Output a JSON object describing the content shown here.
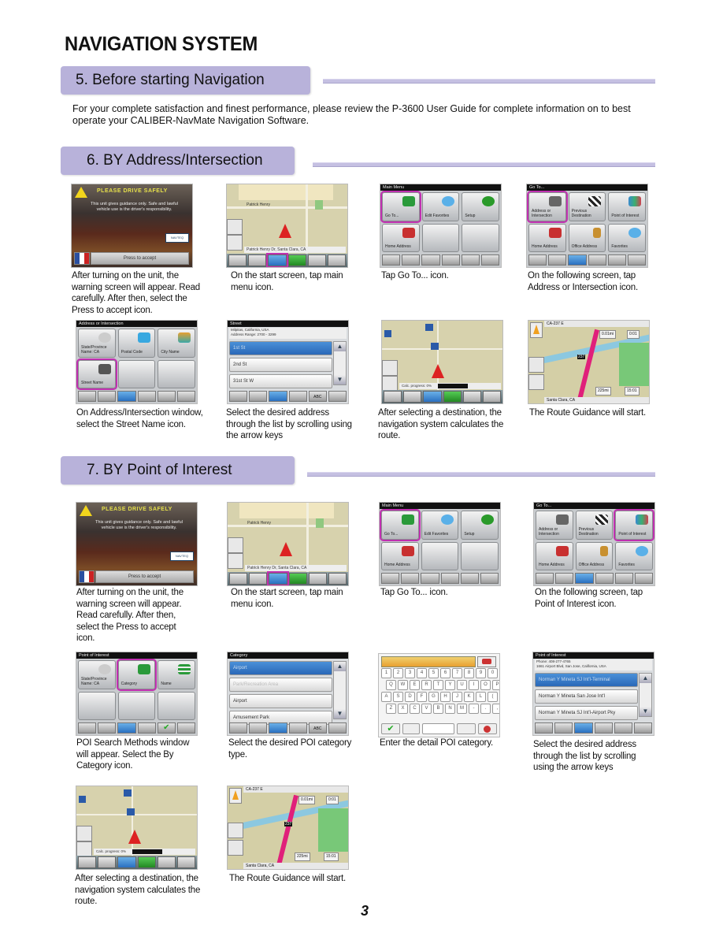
{
  "page": {
    "title": "NAVIGATION SYSTEM",
    "page_number": "3",
    "accent_color": "#b8b2da",
    "highlight_color": "#c030b0"
  },
  "sections": {
    "before": {
      "heading": "5. Before starting Navigation",
      "body": "For your complete satisfaction and finest performance, please review the P-3600 User Guide for complete information on to best operate your CALIBER-NavMate Navigation Software."
    },
    "address": {
      "heading": "6. BY Address/Intersection",
      "steps": [
        {
          "caption": "After turning on the unit, the warning screen will appear. Read carefully. After then, select the Press to accept icon.",
          "screen": "warning"
        },
        {
          "caption": "On the start screen, tap main menu icon.",
          "screen": "map-start"
        },
        {
          "caption": "Tap Go To... icon.",
          "screen": "main-menu"
        },
        {
          "caption": "On the following screen, tap Address or Intersection icon.",
          "screen": "go-to"
        },
        {
          "caption": "On Address/Intersection window, select the Street Name icon.",
          "screen": "address-intersection"
        },
        {
          "caption": "Select the desired address through the list by scrolling using the arrow keys",
          "screen": "street-list"
        },
        {
          "caption": "After selecting a destination, the navigation system calculates the route.",
          "screen": "map-calculating"
        },
        {
          "caption": "The Route Guidance will start.",
          "screen": "route-guidance"
        }
      ]
    },
    "poi": {
      "heading": "7. BY Point of Interest",
      "steps": [
        {
          "caption": "After turning on the unit, the warning screen will appear. Read carefully. After then, select the Press to accept icon.",
          "screen": "warning"
        },
        {
          "caption": "On the start screen, tap main menu icon.",
          "screen": "map-start"
        },
        {
          "caption": "Tap Go To... icon.",
          "screen": "main-menu"
        },
        {
          "caption": "On the following screen, tap Point of Interest icon.",
          "screen": "go-to"
        },
        {
          "caption": "POI Search Methods window will appear. Select the By Category icon.",
          "screen": "poi-methods"
        },
        {
          "caption": "Select the desired POI category type.",
          "screen": "category-list"
        },
        {
          "caption": "Enter the detail POI category.",
          "screen": "keyboard"
        },
        {
          "caption": "Select the desired address through the list by scrolling using the arrow keys",
          "screen": "poi-list"
        },
        {
          "caption": "After selecting a destination, the navigation system calculates the route.",
          "screen": "map-calculating"
        },
        {
          "caption": "The Route Guidance will start.",
          "screen": "route-guidance"
        }
      ]
    }
  },
  "screens": {
    "warning": {
      "title": "PLEASE DRIVE SAFELY",
      "message": "This unit gives guidance only. Safe and lawful vehicle use is the driver's responsibility.",
      "button": "Press to accept",
      "logo": "NAVTEQ"
    },
    "map_start": {
      "street": "Patrick Henry Dr, Santa Clara, CA",
      "label": "Patrick Henry"
    },
    "main_menu": {
      "title": "Main Menu",
      "items": [
        "Go To...",
        "Edit Favorites",
        "Setup",
        "Home Address",
        "",
        ""
      ]
    },
    "go_to": {
      "title": "Go To...",
      "items": [
        "Address or Intersection",
        "Previous Destination",
        "Point of Interest",
        "Home Address",
        "Office Address",
        "Favorites"
      ]
    },
    "address_intersection": {
      "title": "Address or Intersection",
      "items": [
        "State/Province Name: CA",
        "Postal Code",
        "City Name",
        "Street Name",
        "",
        ""
      ]
    },
    "street_list": {
      "title": "Street",
      "sub1": "Milpitas, California, USA",
      "sub2": "Address Range: 2700 - 3299",
      "rows": [
        "1st St",
        "2nd St",
        "31st St W"
      ]
    },
    "map_calculating": {
      "progress_label": "Calc. progress: 0%"
    },
    "route_guidance": {
      "road": "CA-237 E",
      "dist_top": "0.01mi",
      "time_top": "0:01",
      "dist_bottom": "225mi",
      "time_bottom": "15:01",
      "location": "Santa Clara, CA",
      "badge": "237"
    },
    "poi_methods": {
      "title": "Point of Interest",
      "items": [
        "State/Province Name: CA",
        "Category",
        "Name",
        "",
        "",
        ""
      ]
    },
    "category_list": {
      "title": "Category",
      "rows": [
        "Airport",
        "Park/Recreation Area",
        "Airport",
        "Amusement Park"
      ]
    },
    "keyboard": {
      "rows": [
        [
          "1",
          "2",
          "3",
          "4",
          "5",
          "6",
          "7",
          "8",
          "9",
          "0"
        ],
        [
          "Q",
          "W",
          "E",
          "R",
          "T",
          "Y",
          "U",
          "I",
          "O",
          "P"
        ],
        [
          "A",
          "S",
          "D",
          "F",
          "G",
          "H",
          "J",
          "K",
          "L",
          "(",
          ")"
        ],
        [
          "Z",
          "X",
          "C",
          "V",
          "B",
          "N",
          "M",
          "-",
          ".",
          ","
        ]
      ]
    },
    "poi_list": {
      "title": "Point of Interest",
      "sub1": "Phone: 408-277-4765",
      "sub2": "1661 Airport Blvd, San Jose, California, USA",
      "rows": [
        "Norman Y Mineta SJ Int'l-Terminal",
        "Norman Y Mineta San Jose Int'l",
        "Norman Y Mineta SJ Int'l-Airport Pky"
      ]
    }
  }
}
